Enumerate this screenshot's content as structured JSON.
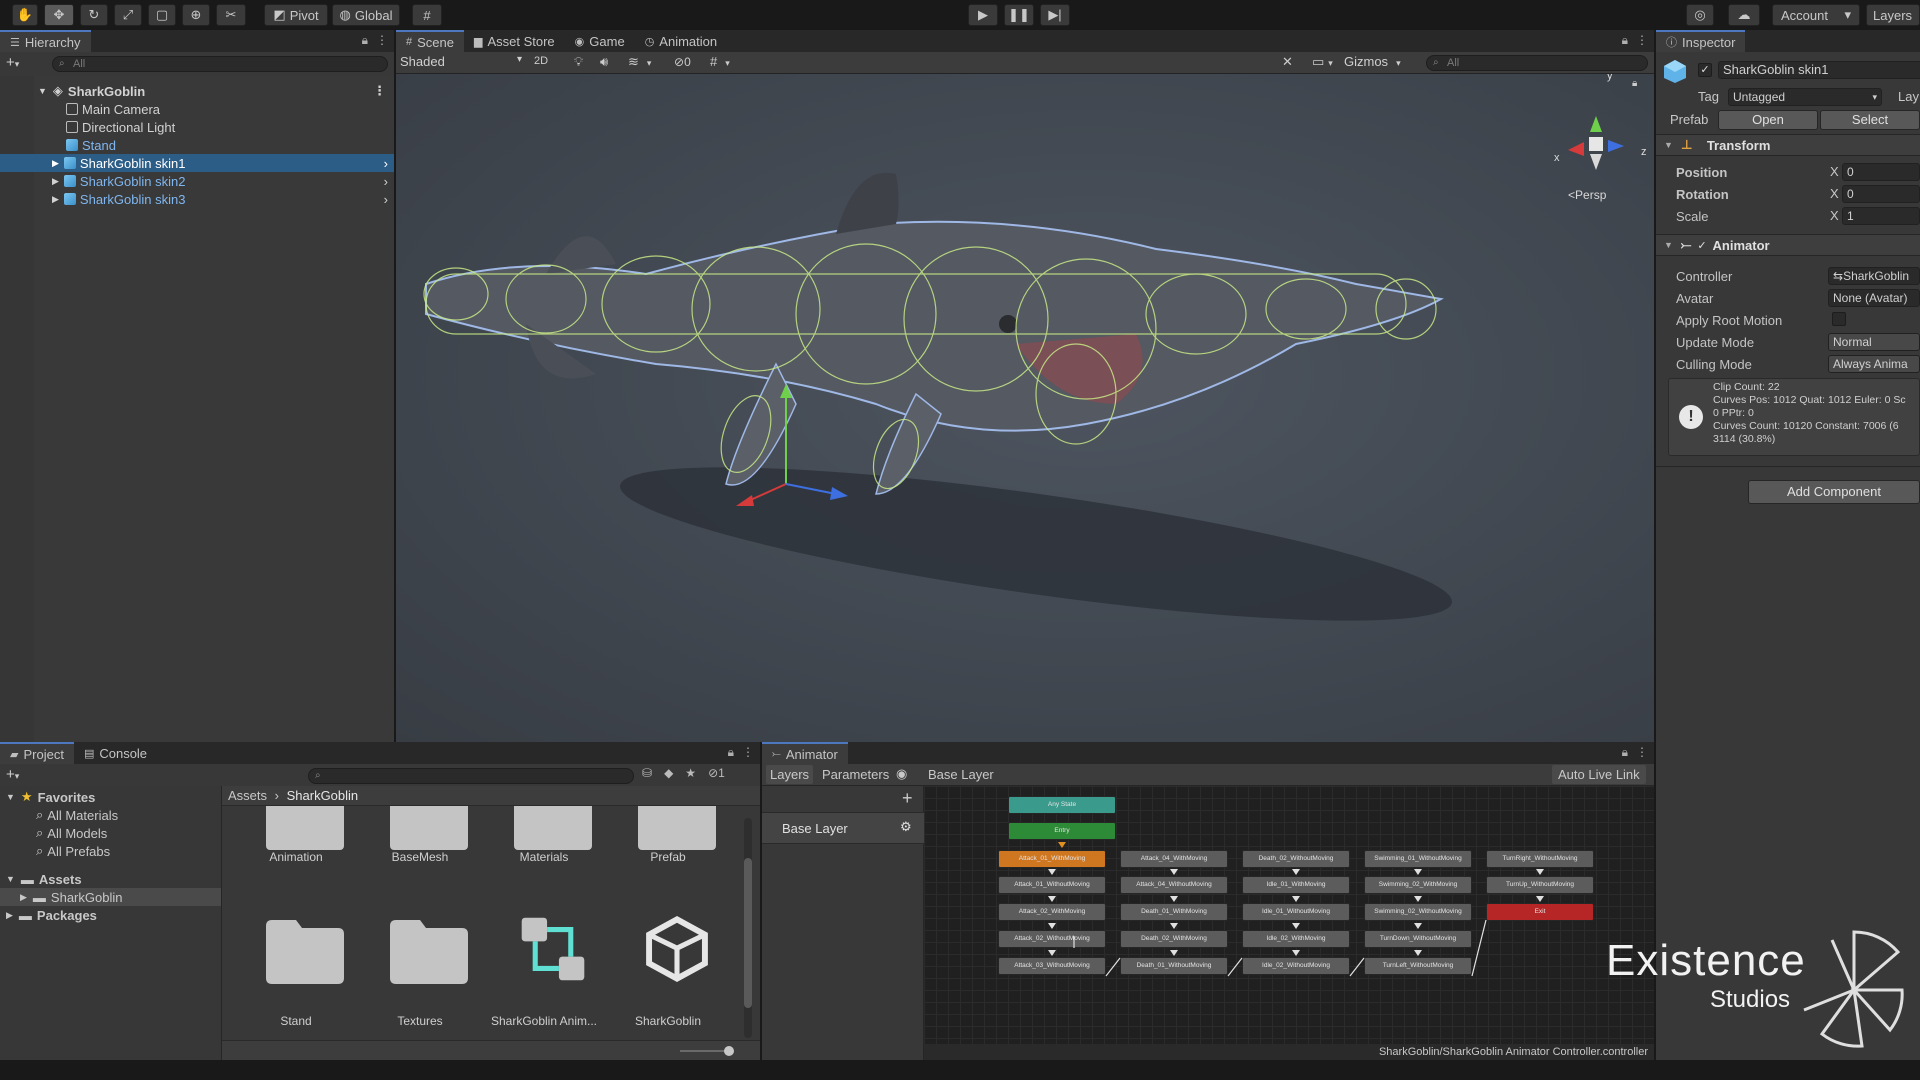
{
  "toolbar": {
    "pivot": "Pivot",
    "global": "Global",
    "account": "Account",
    "layers": "Layers"
  },
  "hierarchy": {
    "tab": "Hierarchy",
    "search_placeholder": "All",
    "root": "SharkGoblin",
    "items": [
      {
        "label": "Main Camera"
      },
      {
        "label": "Directional Light"
      },
      {
        "label": "Stand"
      },
      {
        "label": "SharkGoblin skin1"
      },
      {
        "label": "SharkGoblin skin2"
      },
      {
        "label": "SharkGoblin skin3"
      }
    ]
  },
  "scene": {
    "tabs": [
      {
        "label": "Scene"
      },
      {
        "label": "Asset Store"
      },
      {
        "label": "Game"
      },
      {
        "label": "Animation"
      }
    ],
    "shading": "Shaded",
    "mode_2d": "2D",
    "hidden_count": "0",
    "gizmos": "Gizmos",
    "search_placeholder": "All",
    "persp": "Persp",
    "axis_x": "x",
    "axis_y": "y",
    "axis_z": "z"
  },
  "inspector": {
    "tab": "Inspector",
    "object_name": "SharkGoblin skin1",
    "tag_label": "Tag",
    "tag_value": "Untagged",
    "layer_label": "Lay",
    "prefab_label": "Prefab",
    "prefab_open": "Open",
    "prefab_select": "Select",
    "transform": {
      "title": "Transform",
      "rows": [
        {
          "label": "Position",
          "axis": "X",
          "value": "0"
        },
        {
          "label": "Rotation",
          "axis": "X",
          "value": "0"
        },
        {
          "label": "Scale",
          "axis": "X",
          "value": "1"
        }
      ]
    },
    "animator": {
      "title": "Animator",
      "rows": [
        {
          "label": "Controller",
          "value": "SharkGoblin"
        },
        {
          "label": "Avatar",
          "value": "None (Avatar)"
        },
        {
          "label": "Apply Root Motion",
          "value": ""
        },
        {
          "label": "Update Mode",
          "value": "Normal"
        },
        {
          "label": "Culling Mode",
          "value": "Always Anima"
        }
      ],
      "info_lines": [
        "Clip Count: 22",
        "Curves Pos: 1012 Quat: 1012 Euler: 0 Sc",
        "0 PPtr: 0",
        "Curves Count: 10120 Constant: 7006 (6",
        "3114 (30.8%)"
      ]
    },
    "add_component": "Add Component"
  },
  "project": {
    "tabs": [
      {
        "label": "Project"
      },
      {
        "label": "Console"
      }
    ],
    "badge_count": "1",
    "tree": {
      "favorites": "Favorites",
      "fav_items": [
        {
          "label": "All Materials"
        },
        {
          "label": "All Models"
        },
        {
          "label": "All Prefabs"
        }
      ],
      "assets": "Assets",
      "shark": "SharkGoblin",
      "packages": "Packages"
    },
    "breadcrumb": {
      "root": "Assets",
      "current": "SharkGoblin"
    },
    "tiles": [
      {
        "label": "Animation"
      },
      {
        "label": "BaseMesh"
      },
      {
        "label": "Materials"
      },
      {
        "label": "Prefab"
      },
      {
        "label": "Stand"
      },
      {
        "label": "Textures"
      },
      {
        "label": "SharkGoblin Anim..."
      },
      {
        "label": "SharkGoblin"
      }
    ]
  },
  "animator": {
    "tab": "Animator",
    "layers_tab": "Layers",
    "params_tab": "Parameters",
    "layer_crumb": "Base Layer",
    "auto_live": "Auto Live Link",
    "layer_item": "Base Layer",
    "path": "SharkGoblin/SharkGoblin Animator Controller.controller",
    "any_state": "Any State",
    "entry": "Entry",
    "exit": "Exit",
    "states": [
      [
        "Attack_01_WithMoving",
        "Attack_01_WithoutMoving",
        "Attack_02_WithMoving",
        "Attack_02_WithoutMoving",
        "Attack_03_WithoutMoving"
      ],
      [
        "Attack_04_WithMoving",
        "Attack_04_WithoutMoving",
        "Death_01_WithMoving",
        "Death_02_WithMoving",
        "Death_01_WithoutMoving"
      ],
      [
        "Death_02_WithoutMoving",
        "Idle_01_WithMoving",
        "Idle_01_WithoutMoving",
        "Idle_02_WithMoving",
        "Idle_02_WithoutMoving"
      ],
      [
        "Swimming_01_WithoutMoving",
        "Swimming_02_WithMoving",
        "Swimming_02_WithoutMoving",
        "TurnDown_WithoutMoving",
        "TurnLeft_WithoutMoving"
      ],
      [
        "TurnRight_WithoutMoving",
        "TurnUp_WithoutMoving"
      ]
    ]
  },
  "watermark": {
    "line1": "Existence",
    "line2": "Studios"
  },
  "colors": {
    "selection": "#2c5d87",
    "accent_tab": "#4d78c0",
    "default_state": "#cf7620",
    "entry_state": "#2d8a36",
    "exit_state": "#b62626"
  }
}
